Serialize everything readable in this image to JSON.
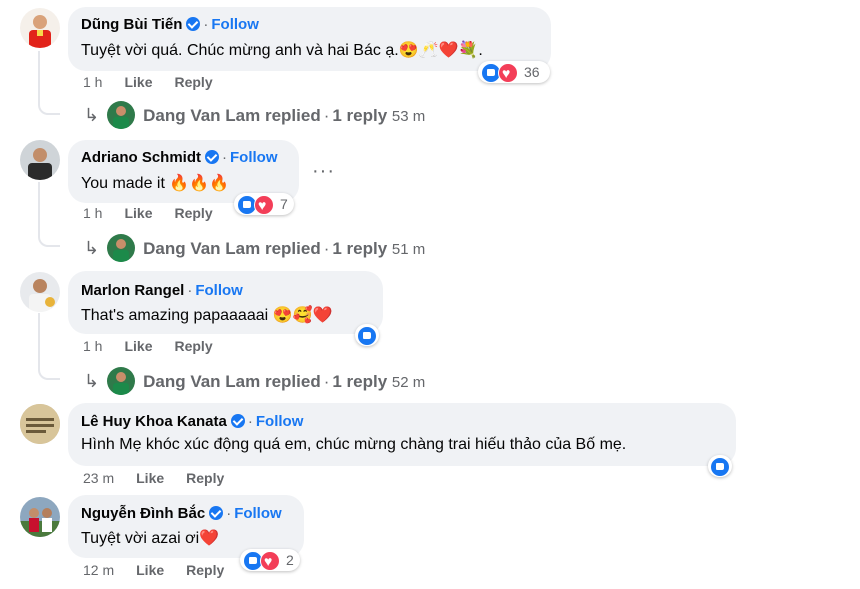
{
  "comments": [
    {
      "author": "Dũng Bùi Tiến",
      "follow": "Follow",
      "text": "Tuyệt vời quá. Chúc mừng anh và hai Bác ạ.😍🥂❤️💐.",
      "time": "1 h",
      "like": "Like",
      "reply": "Reply",
      "reactions": "36",
      "replied_by": "Dang Van Lam replied",
      "reply_count": "1 reply",
      "reply_time": "53 m"
    },
    {
      "author": "Adriano Schmidt",
      "follow": "Follow",
      "text": "You made it 🔥🔥🔥",
      "time": "1 h",
      "like": "Like",
      "reply": "Reply",
      "reactions": "7",
      "more": "···",
      "replied_by": "Dang Van Lam replied",
      "reply_count": "1 reply",
      "reply_time": "51 m"
    },
    {
      "author": "Marlon Rangel",
      "follow": "Follow",
      "text": "That's amazing papaaaaai 😍🥰❤️",
      "time": "1 h",
      "like": "Like",
      "reply": "Reply",
      "replied_by": "Dang Van Lam replied",
      "reply_count": "1 reply",
      "reply_time": "52 m"
    },
    {
      "author": "Lê Huy Khoa Kanata",
      "follow": "Follow",
      "text": "Hình Mẹ khóc xúc động quá em, chúc mừng chàng trai hiếu thảo của Bố mẹ.",
      "time": "23 m",
      "like": "Like",
      "reply": "Reply"
    },
    {
      "author": "Nguyễn Đình Bắc",
      "follow": "Follow",
      "text": "Tuyệt vời azai ơi❤️",
      "time": "12 m",
      "like": "Like",
      "reply": "Reply",
      "reactions": "2"
    }
  ],
  "separator": "·",
  "reply_arrow": "↳",
  "colors": {
    "link": "#1877f2",
    "muted": "#65676b",
    "bubble": "#f0f2f5",
    "heart": "#f33e58"
  }
}
